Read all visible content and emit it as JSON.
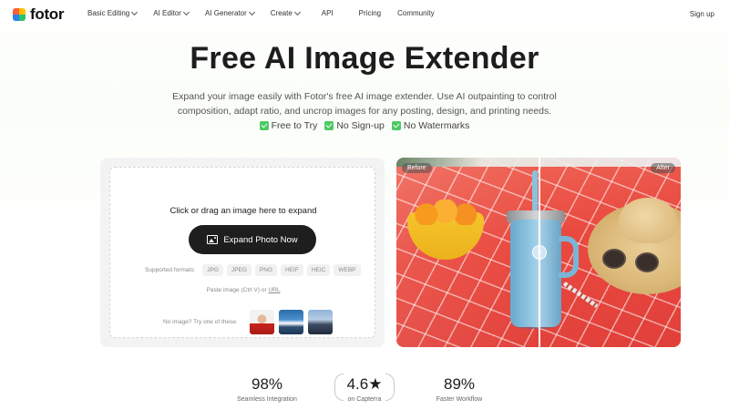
{
  "nav": {
    "logo_text": "fotor",
    "menu": [
      {
        "label": "Basic Editing",
        "has_dropdown": true
      },
      {
        "label": "AI Editor",
        "has_dropdown": true
      },
      {
        "label": "AI Generator",
        "has_dropdown": true
      },
      {
        "label": "Create",
        "has_dropdown": true
      },
      {
        "label": "API",
        "has_dropdown": false
      },
      {
        "label": "Pricing",
        "has_dropdown": false
      },
      {
        "label": "Community",
        "has_dropdown": false
      }
    ],
    "signup_label": "Sign up"
  },
  "hero": {
    "title": "Free AI Image Extender",
    "subtitle": "Expand your image easily with Fotor's free AI image extender. Use AI outpainting to control composition, adapt ratio, and uncrop images for any posting, design, and printing needs.",
    "perks": [
      "Free to Try",
      "No Sign-up",
      "No Watermarks"
    ]
  },
  "upload": {
    "drop_text": "Click or drag an image here to expand",
    "button_label": "Expand Photo Now",
    "formats_label": "Supported formats:",
    "formats": [
      "JPG",
      "JPEG",
      "PNG",
      "HEIF",
      "HEIC",
      "WEBP"
    ],
    "paste_text": "Paste image (Ctrl V) or ",
    "paste_link": "URL",
    "samples_label": "No image? Try one of these:"
  },
  "preview": {
    "before_label": "Before",
    "after_label": "After",
    "handle_symbol": "‹›"
  },
  "stats": [
    {
      "value": "98%",
      "label": "Seamless Integration"
    },
    {
      "value": "4.6★",
      "label": "on Capterra"
    },
    {
      "value": "89%",
      "label": "Faster Workflow"
    }
  ],
  "colors": {
    "accent_check": "#4cc964",
    "button_bg": "#1e1e1e",
    "title": "#1d1d1d"
  }
}
